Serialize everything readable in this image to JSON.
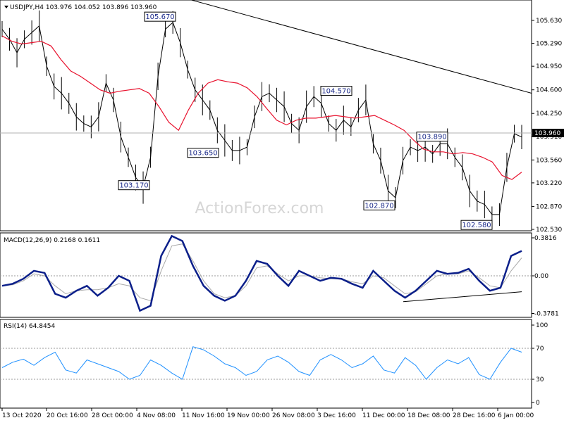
{
  "chart_data": [
    {
      "type": "line",
      "symbol": "USDJPY,H4",
      "ohlc": {
        "open": "103.976",
        "high": "104.052",
        "low": "103.896",
        "close": "103.960"
      },
      "ylim": [
        102.53,
        105.63
      ],
      "yticks": [
        "105.630",
        "105.290",
        "104.950",
        "104.600",
        "104.250",
        "103.910",
        "103.560",
        "103.220",
        "102.870",
        "102.530"
      ],
      "current_price": "103.960",
      "x_labels": [
        "13 Oct 2020",
        "20 Oct 16:00",
        "28 Oct 00:00",
        "4 Nov 08:00",
        "11 Nov 16:00",
        "19 Nov 00:00",
        "26 Nov 08:00",
        "3 Dec 16:00",
        "11 Dec 00:00",
        "18 Dec 08:00",
        "28 Dec 16:00",
        "6 Jan 00:00"
      ],
      "annotations": [
        {
          "text": "105.670",
          "value": 105.67
        },
        {
          "text": "103.170",
          "value": 103.17
        },
        {
          "text": "103.650",
          "value": 103.65
        },
        {
          "text": "104.570",
          "value": 104.57
        },
        {
          "text": "102.870",
          "value": 102.87
        },
        {
          "text": "103.890",
          "value": 103.89
        },
        {
          "text": "102.580",
          "value": 102.58
        }
      ],
      "price_series": [
        105.5,
        105.35,
        105.15,
        105.35,
        105.45,
        105.55,
        104.95,
        104.65,
        104.55,
        104.4,
        104.2,
        104.1,
        104.05,
        104.2,
        104.7,
        104.45,
        103.9,
        103.6,
        103.3,
        103.15,
        103.6,
        104.8,
        105.5,
        105.6,
        105.3,
        104.9,
        104.6,
        104.45,
        104.3,
        104.0,
        103.85,
        103.7,
        103.7,
        103.75,
        104.2,
        104.5,
        104.55,
        104.45,
        104.35,
        104.1,
        104.0,
        104.35,
        104.5,
        104.4,
        104.1,
        104.0,
        104.15,
        104.05,
        104.3,
        104.45,
        103.8,
        103.55,
        103.1,
        103.0,
        103.55,
        103.75,
        103.7,
        103.75,
        103.65,
        103.8,
        103.8,
        103.6,
        103.45,
        103.1,
        102.95,
        102.9,
        102.75,
        102.75,
        103.45,
        103.95,
        103.9
      ],
      "ma_series": [
        105.4,
        105.32,
        105.28,
        105.3,
        105.32,
        105.25,
        105.05,
        104.88,
        104.8,
        104.7,
        104.6,
        104.55,
        104.58,
        104.6,
        104.62,
        104.55,
        104.35,
        104.12,
        104.0,
        104.3,
        104.55,
        104.7,
        104.75,
        104.72,
        104.7,
        104.63,
        104.5,
        104.32,
        104.15,
        104.08,
        104.15,
        104.18,
        104.18,
        104.2,
        104.22,
        104.2,
        104.18,
        104.2,
        104.22,
        104.15,
        104.08,
        104.0,
        103.85,
        103.72,
        103.68,
        103.68,
        103.65,
        103.67,
        103.65,
        103.6,
        103.53,
        103.33,
        103.27,
        103.38
      ],
      "trendline": {
        "from": 105.98,
        "to": 104.55
      }
    },
    {
      "type": "line",
      "title": "MACD(12,26,9) 0.2168 0.1611",
      "yticks": [
        "0.3816",
        "0.00",
        "-0.3781"
      ],
      "ylim": [
        -0.3781,
        0.3816
      ],
      "macd": [
        -0.1,
        -0.08,
        -0.03,
        0.05,
        0.03,
        -0.18,
        -0.22,
        -0.15,
        -0.1,
        -0.2,
        -0.12,
        0.0,
        -0.05,
        -0.35,
        -0.3,
        0.2,
        0.4,
        0.35,
        0.1,
        -0.1,
        -0.2,
        -0.25,
        -0.2,
        -0.05,
        0.15,
        0.12,
        0.0,
        -0.1,
        0.05,
        0.0,
        -0.05,
        -0.02,
        -0.03,
        -0.08,
        -0.12,
        0.05,
        -0.05,
        -0.15,
        -0.22,
        -0.15,
        -0.05,
        0.05,
        0.02,
        0.03,
        0.07,
        -0.05,
        -0.15,
        -0.12,
        0.2,
        0.25
      ],
      "signal": [
        -0.1,
        -0.09,
        -0.05,
        0.02,
        0.0,
        -0.1,
        -0.18,
        -0.15,
        -0.14,
        -0.14,
        -0.12,
        -0.08,
        -0.1,
        -0.22,
        -0.25,
        0.05,
        0.3,
        0.32,
        0.15,
        -0.05,
        -0.18,
        -0.22,
        -0.2,
        -0.1,
        0.08,
        0.1,
        0.02,
        -0.05,
        0.0,
        0.0,
        -0.02,
        -0.03,
        -0.03,
        -0.06,
        -0.08,
        0.0,
        -0.02,
        -0.1,
        -0.18,
        -0.16,
        -0.08,
        0.0,
        0.02,
        0.02,
        0.05,
        -0.02,
        -0.1,
        -0.12,
        0.05,
        0.18
      ],
      "trendline": {
        "from": -0.26,
        "to": -0.16
      }
    },
    {
      "type": "line",
      "title": "RSI(14) 64.8454",
      "ylim": [
        0,
        100
      ],
      "yticks": [
        "100",
        "70",
        "30",
        "0"
      ],
      "levels": [
        70,
        30
      ],
      "rsi": [
        45,
        52,
        56,
        48,
        58,
        65,
        42,
        38,
        55,
        50,
        45,
        40,
        30,
        35,
        55,
        48,
        38,
        30,
        72,
        68,
        60,
        50,
        45,
        35,
        40,
        55,
        60,
        52,
        40,
        35,
        55,
        62,
        55,
        45,
        50,
        60,
        42,
        38,
        58,
        48,
        30,
        45,
        55,
        50,
        58,
        36,
        30,
        52,
        70,
        65
      ]
    }
  ],
  "watermark": "ActionForex.com"
}
